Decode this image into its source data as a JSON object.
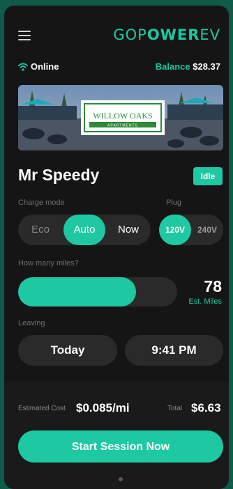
{
  "header": {
    "logo_prefix": "GOP",
    "logo_bold": "OWER",
    "logo_suffix": "EV",
    "menu_icon": "hamburger-icon"
  },
  "status": {
    "connection": "Online",
    "wifi_icon": "wifi-icon",
    "balance_label": "Balance",
    "balance_value": "$28.37"
  },
  "location": {
    "name": "WILLOW OAKS",
    "subtitle": "APARTMENTS"
  },
  "vehicle": {
    "name": "Mr Speedy",
    "status": "Idle"
  },
  "charge_mode": {
    "label": "Charge mode",
    "options": [
      "Eco",
      "Auto",
      "Now"
    ],
    "selected": "Auto"
  },
  "plug": {
    "label": "Plug",
    "options": [
      "120V",
      "240V"
    ],
    "selected": "120V"
  },
  "miles": {
    "label": "How many miles?",
    "value": "78",
    "unit": "Est. Miles",
    "fill_fraction": 0.74
  },
  "leaving": {
    "label": "Leaving",
    "day": "Today",
    "time": "9:41 PM"
  },
  "cost": {
    "estimated_label": "Estimated Cost",
    "estimated_value": "$0.085/mi",
    "total_label": "Total",
    "total_value": "$6.63"
  },
  "action": {
    "start_label": "Start Session Now"
  },
  "colors": {
    "accent": "#1ec8a2",
    "background": "#151515",
    "surface": "#2a2a2a",
    "outer": "#0f5a4b"
  }
}
